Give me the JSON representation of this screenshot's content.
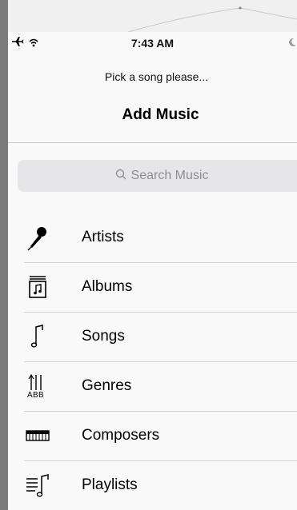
{
  "status": {
    "time": "7:43 AM"
  },
  "header": {
    "prompt": "Pick a song please...",
    "title": "Add Music"
  },
  "search": {
    "placeholder": "Search Music"
  },
  "categories": [
    {
      "label": "Artists",
      "icon": "microphone-icon"
    },
    {
      "label": "Albums",
      "icon": "album-icon"
    },
    {
      "label": "Songs",
      "icon": "music-note-icon"
    },
    {
      "label": "Genres",
      "icon": "genres-icon"
    },
    {
      "label": "Composers",
      "icon": "piano-icon"
    },
    {
      "label": "Playlists",
      "icon": "playlist-icon"
    }
  ]
}
